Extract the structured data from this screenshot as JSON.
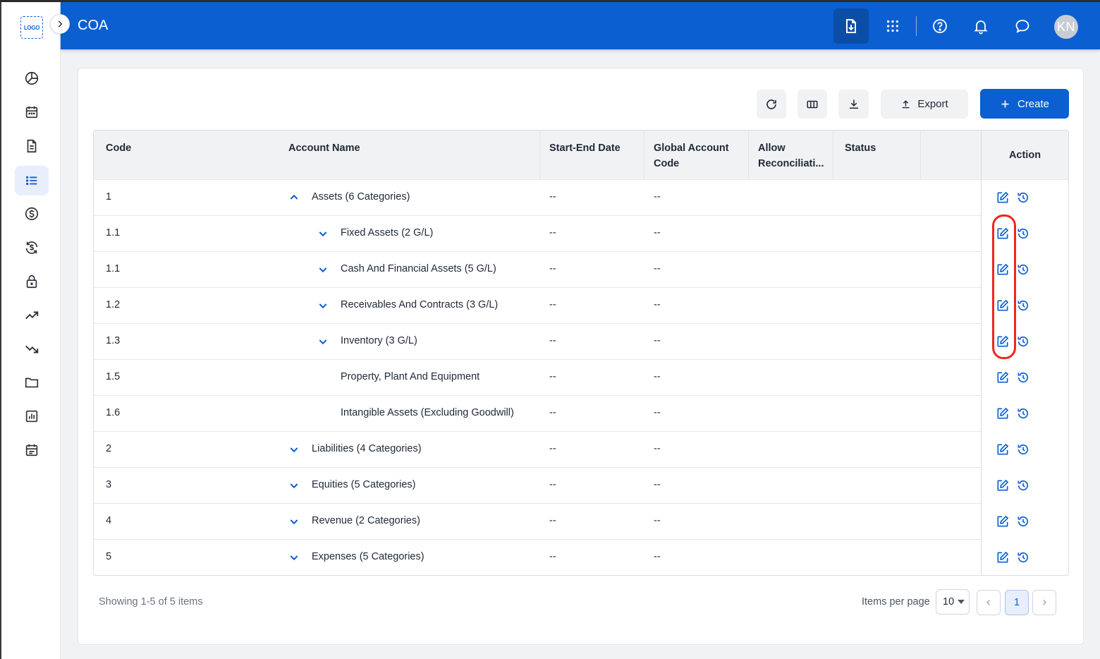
{
  "header": {
    "title": "COA",
    "avatar_initials": "KN",
    "brand_color": "#0b5fd1"
  },
  "sidebar": {
    "logo_text": "LOGO",
    "items": [
      {
        "icon": "pie-chart-icon",
        "active": false
      },
      {
        "icon": "calendar-icon",
        "active": false
      },
      {
        "icon": "document-icon",
        "active": false
      },
      {
        "icon": "list-icon",
        "active": true
      },
      {
        "icon": "dollar-circle-icon",
        "active": false
      },
      {
        "icon": "currency-exchange-icon",
        "active": false
      },
      {
        "icon": "lock-icon",
        "active": false
      },
      {
        "icon": "trending-up-icon",
        "active": false
      },
      {
        "icon": "trending-down-icon",
        "active": false
      },
      {
        "icon": "folder-icon",
        "active": false
      },
      {
        "icon": "bar-report-icon",
        "active": false
      },
      {
        "icon": "schedule-icon",
        "active": false
      }
    ]
  },
  "toolbar": {
    "export_label": "Export",
    "create_label": "Create"
  },
  "table": {
    "columns": [
      "Code",
      "Account Name",
      "Start-End Date",
      "Global Account Code",
      "Allow Reconciliati...",
      "Status",
      "Action"
    ],
    "rows": [
      {
        "code": "1",
        "name": "Assets (6 Categories)",
        "start_end": "--",
        "global_code": "--",
        "chevron": "up",
        "level": 0
      },
      {
        "code": "1.1",
        "name": "Fixed Assets (2 G/L)",
        "start_end": "--",
        "global_code": "--",
        "chevron": "down",
        "level": 1
      },
      {
        "code": "1.1",
        "name": "Cash And Financial Assets (5 G/L)",
        "start_end": "--",
        "global_code": "--",
        "chevron": "down",
        "level": 1
      },
      {
        "code": "1.2",
        "name": "Receivables And Contracts (3 G/L)",
        "start_end": "--",
        "global_code": "--",
        "chevron": "down",
        "level": 1
      },
      {
        "code": "1.3",
        "name": "Inventory (3 G/L)",
        "start_end": "--",
        "global_code": "--",
        "chevron": "down",
        "level": 1
      },
      {
        "code": "1.5",
        "name": "Property, Plant And Equipment",
        "start_end": "--",
        "global_code": "--",
        "chevron": "none",
        "level": 1
      },
      {
        "code": "1.6",
        "name": "Intangible Assets (Excluding Goodwill)",
        "start_end": "--",
        "global_code": "--",
        "chevron": "none",
        "level": 1
      },
      {
        "code": "2",
        "name": "Liabilities (4 Categories)",
        "start_end": "--",
        "global_code": "--",
        "chevron": "down",
        "level": 0
      },
      {
        "code": "3",
        "name": "Equities (5 Categories)",
        "start_end": "--",
        "global_code": "--",
        "chevron": "down",
        "level": 0
      },
      {
        "code": "4",
        "name": "Revenue (2 Categories)",
        "start_end": "--",
        "global_code": "--",
        "chevron": "down",
        "level": 0
      },
      {
        "code": "5",
        "name": "Expenses (5 Categories)",
        "start_end": "--",
        "global_code": "--",
        "chevron": "down",
        "level": 0
      }
    ]
  },
  "pagination": {
    "showing": "Showing 1-5 of 5 items",
    "items_per_page_label": "Items per page",
    "items_per_page_value": "10",
    "current_page": "1"
  },
  "highlight_color": "#f0261d"
}
